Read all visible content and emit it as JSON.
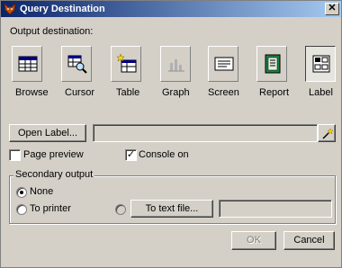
{
  "window": {
    "title": "Query Destination",
    "close_glyph": "✕"
  },
  "output_destination": {
    "label": "Output destination:",
    "tools": [
      {
        "label": "Browse",
        "icon": "browse-icon",
        "pressed": false
      },
      {
        "label": "Cursor",
        "icon": "cursor-icon",
        "pressed": false
      },
      {
        "label": "Table",
        "icon": "table-icon",
        "pressed": false
      },
      {
        "label": "Graph",
        "icon": "graph-icon",
        "pressed": false
      },
      {
        "label": "Screen",
        "icon": "screen-icon",
        "pressed": false
      },
      {
        "label": "Report",
        "icon": "report-icon",
        "pressed": false
      },
      {
        "label": "Label",
        "icon": "label-icon",
        "pressed": true
      }
    ]
  },
  "open_label": {
    "button": "Open Label...",
    "path_value": ""
  },
  "options": {
    "page_preview": {
      "label": "Page preview",
      "checked": false
    },
    "console_on": {
      "label": "Console on",
      "checked": true
    }
  },
  "secondary_output": {
    "label": "Secondary output",
    "none": {
      "label": "None",
      "selected": true
    },
    "to_printer": {
      "label": "To printer",
      "selected": false
    },
    "to_text_file_button": "To text file...",
    "text_file_value": ""
  },
  "buttons": {
    "ok": "OK",
    "cancel": "Cancel"
  },
  "colors": {
    "title_start": "#0a246a",
    "title_end": "#a6caf0",
    "face": "#d4d0c8"
  }
}
